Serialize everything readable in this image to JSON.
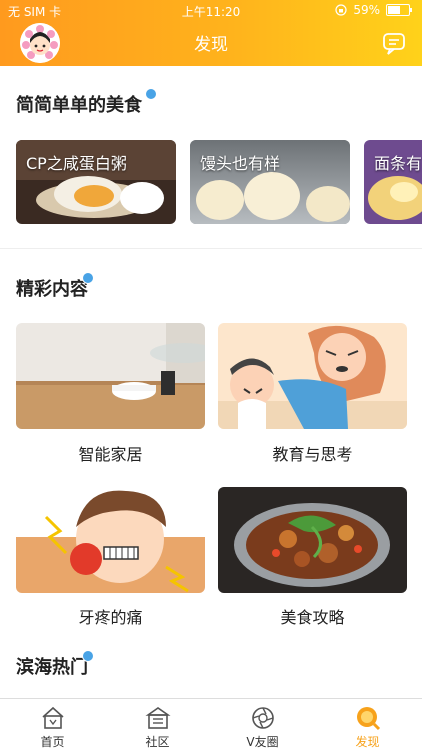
{
  "status_bar": {
    "carrier": "无 SIM 卡",
    "time": "上午11:20",
    "battery": "59%"
  },
  "header": {
    "title": "发现"
  },
  "sections": {
    "food": {
      "title": "简简单单的美食",
      "cards": [
        {
          "label": "CP之咸蛋白粥"
        },
        {
          "label": "馒头也有样"
        },
        {
          "label": "面条有"
        }
      ]
    },
    "featured": {
      "title": "精彩内容",
      "items": [
        {
          "label": "智能家居"
        },
        {
          "label": "教育与思考"
        },
        {
          "label": "牙疼的痛"
        },
        {
          "label": "美食攻略"
        }
      ]
    },
    "hot": {
      "title": "滨海热门"
    }
  },
  "tabbar": {
    "items": [
      {
        "label": "首页"
      },
      {
        "label": "社区"
      },
      {
        "label": "V友圈"
      },
      {
        "label": "发现"
      }
    ],
    "active": "发现"
  },
  "colors": {
    "header_start": "#ff9a1e",
    "header_end": "#ffd21a",
    "active_tab": "#f7a21b",
    "badge": "#49a3e6"
  }
}
